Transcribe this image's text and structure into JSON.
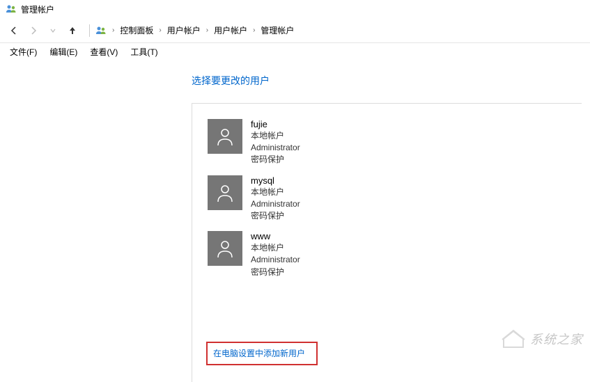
{
  "window": {
    "title": "管理帐户"
  },
  "breadcrumb": {
    "items": [
      "控制面板",
      "用户帐户",
      "用户帐户",
      "管理帐户"
    ]
  },
  "menu": {
    "file": "文件(F)",
    "edit": "编辑(E)",
    "view": "查看(V)",
    "tools": "工具(T)"
  },
  "page": {
    "heading": "选择要更改的用户",
    "add_user_link": "在电脑设置中添加新用户"
  },
  "accounts": [
    {
      "name": "fujie",
      "type": "本地帐户",
      "role": "Administrator",
      "protection": "密码保护"
    },
    {
      "name": "mysql",
      "type": "本地帐户",
      "role": "Administrator",
      "protection": "密码保护"
    },
    {
      "name": "www",
      "type": "本地帐户",
      "role": "Administrator",
      "protection": "密码保护"
    }
  ],
  "watermark": {
    "text": "系统之家"
  }
}
